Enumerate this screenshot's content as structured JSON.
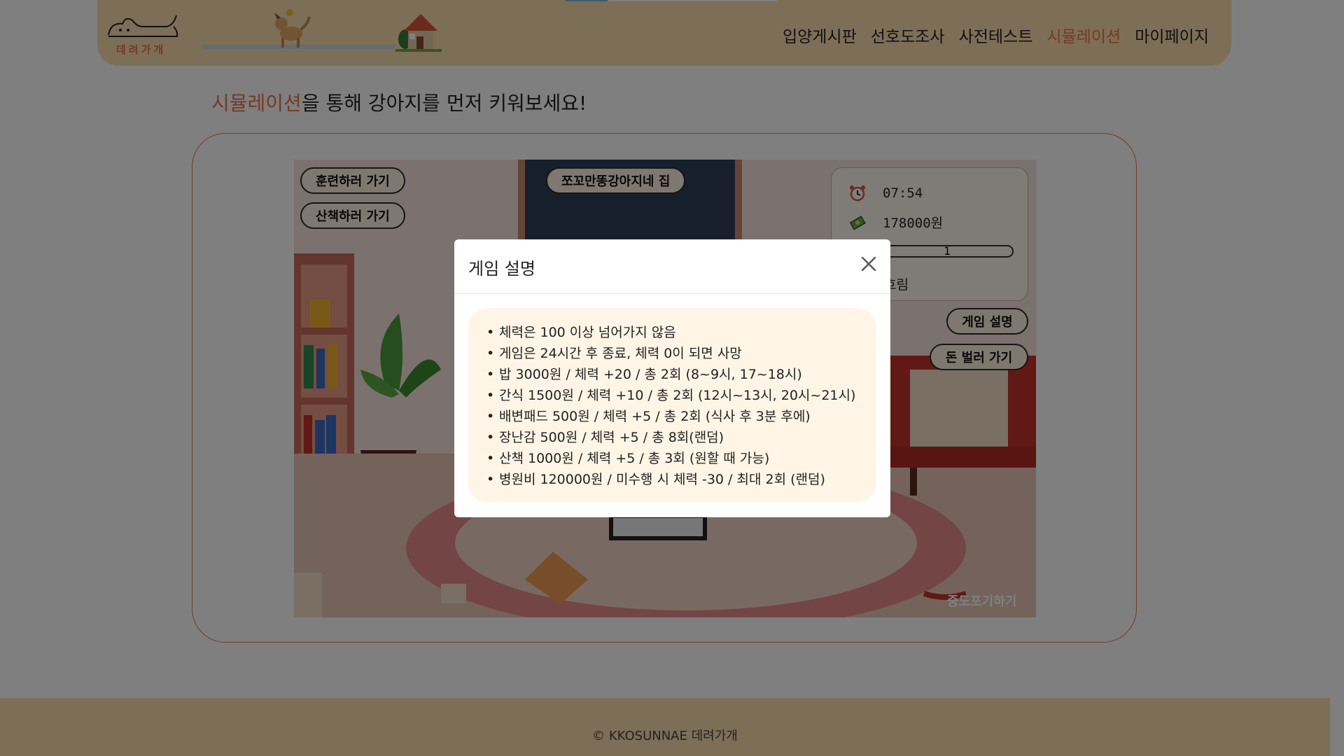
{
  "header": {
    "logo_text": "데려가개",
    "nav": [
      {
        "label": "입양게시판"
      },
      {
        "label": "선호도조사"
      },
      {
        "label": "사전테스트"
      },
      {
        "label": "시뮬레이션",
        "active": true
      },
      {
        "label": "마이페이지"
      }
    ]
  },
  "headline": {
    "accent": "시뮬레이션",
    "rest": "을 통해 강아지를 먼저 키워보세요!"
  },
  "game": {
    "buttons": {
      "train": "훈련하러 가기",
      "walk": "산책하러 가기",
      "house": "쪼꼬만똥강아지네 집",
      "guide": "게임 설명",
      "earn": "돈 벌러 가기",
      "quit": "중도포기하기"
    },
    "status": {
      "time": "07:54",
      "money": "178000원",
      "stamina_label": "1",
      "weather": "흐림"
    }
  },
  "modal": {
    "title": "게임 설명",
    "rules": [
      "체력은 100 이상 넘어가지 않음",
      "게임은 24시간 후 종료, 체력 0이 되면 사망",
      "밥 3000원 / 체력 +20 / 총 2회 (8~9시, 17~18시)",
      "간식 1500원 / 체력 +10 / 총 2회 (12시~13시, 20시~21시)",
      "배변패드 500원 / 체력 +5 / 총 2회 (식사 후 3분 후에)",
      "장난감 500원 / 체력 +5 / 총 8회(랜덤)",
      "산책 1000원 / 체력 +5 / 총 3회 (원할 때 가능)",
      "병원비 120000원 / 미수행 시 체력 -30 / 최대 2회 (랜덤)"
    ]
  },
  "footer": {
    "text": "© KKOSUNNAE 데려가개"
  },
  "colors": {
    "accent": "#e8774a",
    "header_bg": "#fbdcae",
    "rules_bg": "#fef5e6"
  }
}
